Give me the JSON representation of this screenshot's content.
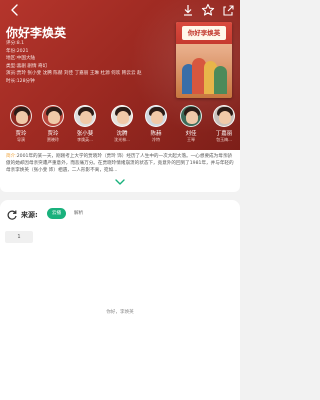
{
  "header": {
    "title": "你好李焕英",
    "icons": [
      "back-icon",
      "download-icon",
      "star-icon",
      "share-icon"
    ]
  },
  "info": [
    {
      "key": "评分:",
      "value": "8.1"
    },
    {
      "key": "年份:",
      "value": "2021"
    },
    {
      "key": "地区:",
      "value": "中国大陆"
    },
    {
      "key": "类型:",
      "value": "喜剧 剧情 奇幻"
    },
    {
      "key": "演员:",
      "value": "贾玲 张小斐 沈腾 陈赫 刘佳 丁嘉丽 王琳 杜源 何欢 韩云云 赵"
    },
    {
      "key": "时长:",
      "value": "128分钟"
    }
  ],
  "poster": {
    "title": "你好李焕英"
  },
  "cast": [
    {
      "name": "贾玲",
      "role": "导演"
    },
    {
      "name": "贾玲",
      "role": "贾晓玲"
    },
    {
      "name": "张小斐",
      "role": "李焕英..."
    },
    {
      "name": "沈腾",
      "role": "沈光林..."
    },
    {
      "name": "陈赫",
      "role": "冷特"
    },
    {
      "name": "刘佳",
      "role": "王琴"
    },
    {
      "name": "丁嘉丽",
      "role": "包玉梅..."
    }
  ],
  "synopsis": {
    "label": "简介:",
    "text": "2001年的某一天，刚刚考上大学的贾晓玲（贾玲 饰）经历了人生中的一次大起大落。一心想要成为母亲骄傲的她却因母亲突遭严重意外，而悲痛万分。在贾晓玲情绪崩溃的状态下，竟意外的回到了1981年，并与年轻的母亲李焕英（张小斐 饰）相遇，二人形影不离，宛如..."
  },
  "sources": {
    "label": "来源:",
    "chip": "云播",
    "parse": "解析",
    "episodes": [
      "1"
    ]
  },
  "footer": {
    "text": "你好，李焕英"
  },
  "colors": {
    "accent": "#19b17c",
    "hero": "#a82f26",
    "highlight": "#f0a33b"
  }
}
